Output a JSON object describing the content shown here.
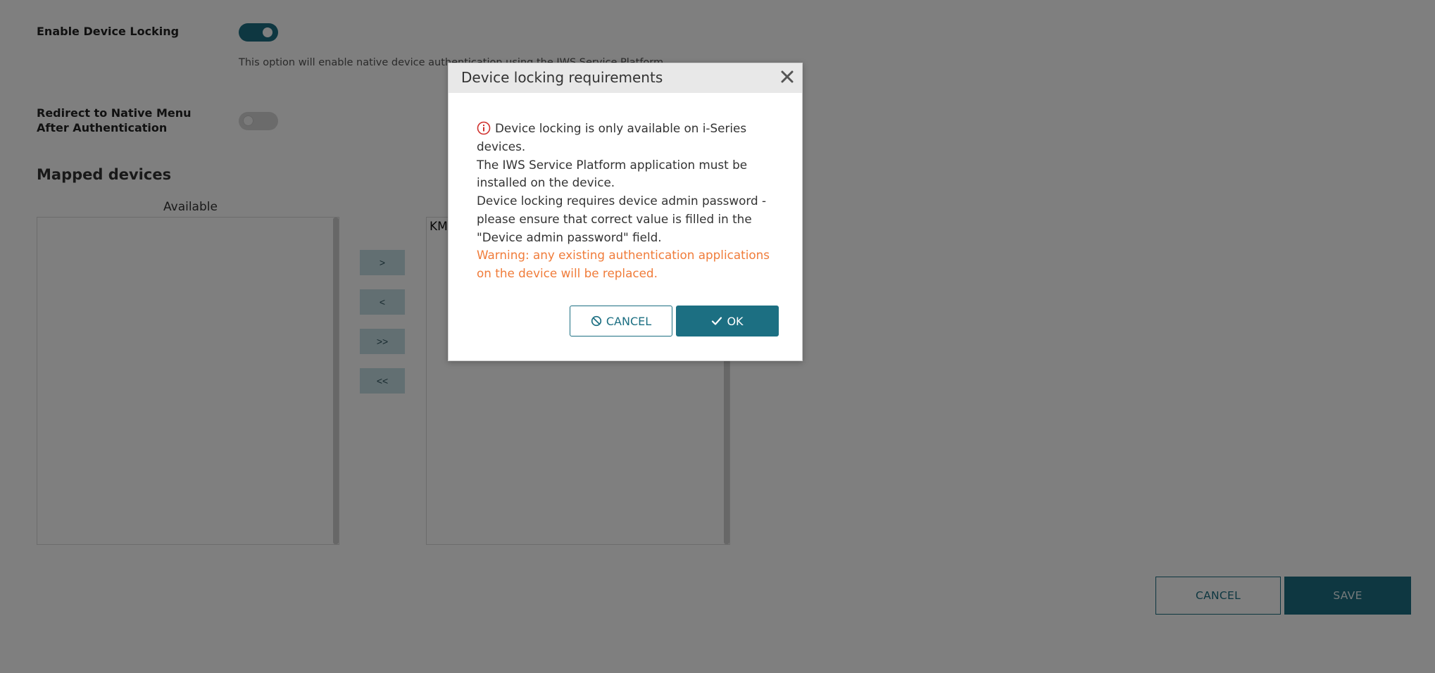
{
  "settings": {
    "enable_locking_label": "Enable Device Locking",
    "enable_locking_help": "This option will enable native device authentication using the IWS Service Platform",
    "redirect_label": "Redirect to Native Menu After Authentication"
  },
  "mapped_devices": {
    "title": "Mapped devices",
    "available_caption": "Available",
    "selected_first_item": "KM",
    "move_right": ">",
    "move_left": "<",
    "move_all_right": ">>",
    "move_all_left": "<<"
  },
  "footer": {
    "cancel_label": "CANCEL",
    "save_label": "SAVE"
  },
  "modal": {
    "title": "Device locking requirements",
    "line1": "Device locking is only available on i-Series devices.",
    "line2": "The IWS Service Platform application must be installed on the device.",
    "line3": "Device locking requires device admin password - please ensure that correct value is filled in the \"Device admin password\" field.",
    "warning": "Warning: any existing authentication applications on the device will be replaced.",
    "cancel_label": "CANCEL",
    "ok_label": "OK"
  },
  "colors": {
    "accent": "#1c6f82",
    "warning": "#f07c3a",
    "info_icon": "#d0312d"
  },
  "icons": {
    "close": "close-icon",
    "info": "info-circle-icon",
    "cancel": "ban-icon",
    "ok": "check-icon"
  }
}
